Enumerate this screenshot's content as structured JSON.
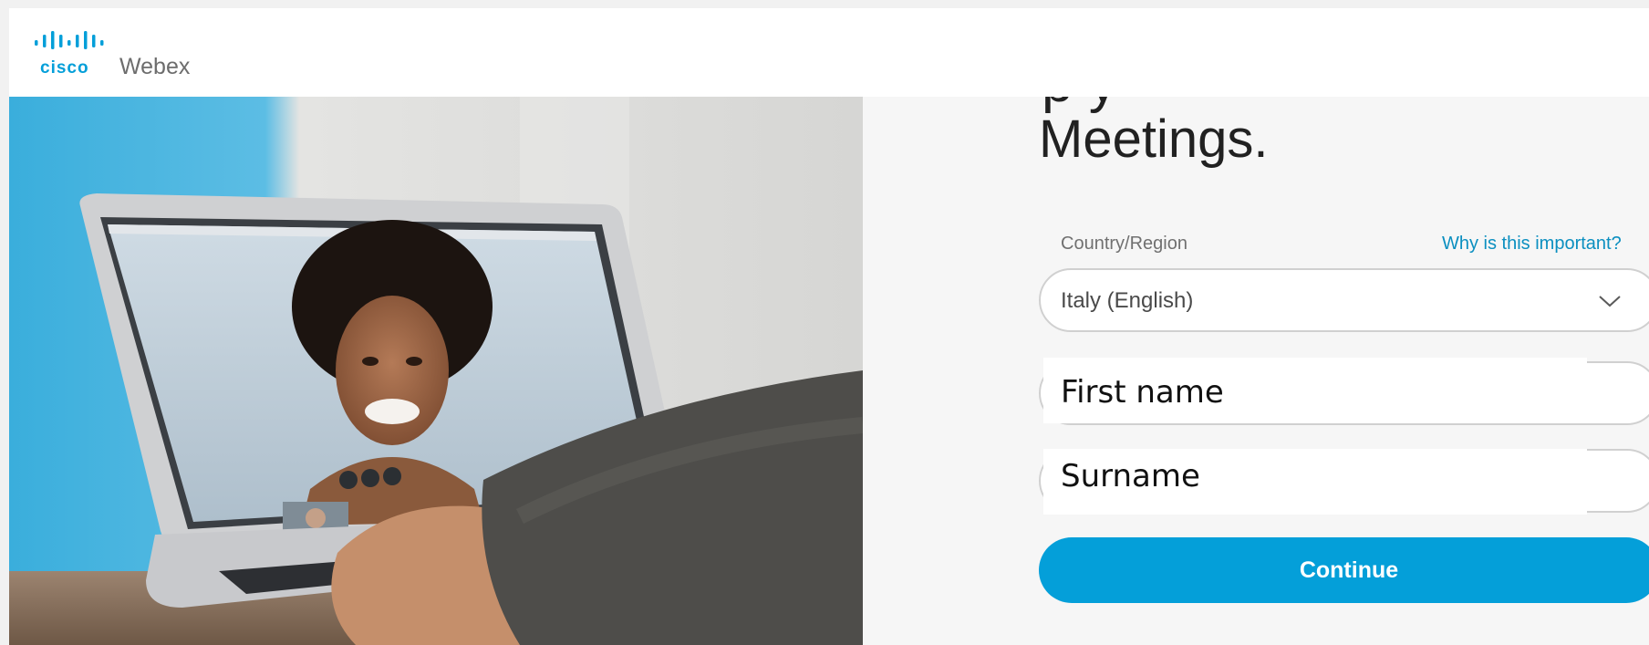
{
  "header": {
    "brand": "cisco",
    "product": "Webex"
  },
  "hero": {
    "image": "person-on-video-call-laptop"
  },
  "form": {
    "heading": "Meetings.",
    "country_label": "Country/Region",
    "why_link": "Why is this important?",
    "country_value": "Italy (English)",
    "first_name_label": "First name",
    "surname_label": "Surname",
    "continue_label": "Continue"
  },
  "colors": {
    "accent": "#049fd9",
    "link": "#0b8fc0"
  },
  "icons": {
    "logo": "cisco-logo-icon",
    "dropdown": "chevron-down-icon"
  }
}
